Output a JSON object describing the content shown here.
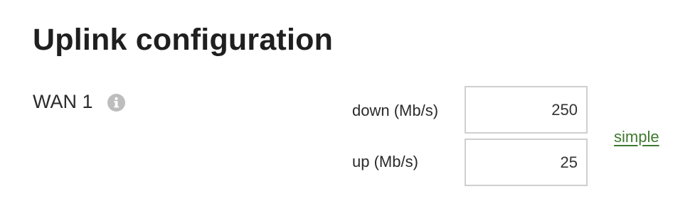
{
  "page": {
    "title": "Uplink configuration"
  },
  "uplink": {
    "wan_label": "WAN 1",
    "info_icon": "info-circle-icon",
    "down_label": "down (Mb/s)",
    "down_value": "250",
    "up_label": "up (Mb/s)",
    "up_value": "25",
    "mode_link": "simple"
  },
  "colors": {
    "link": "#3e7a2e",
    "info_icon": "#bdbdbd",
    "input_border": "#cfcfcf"
  }
}
